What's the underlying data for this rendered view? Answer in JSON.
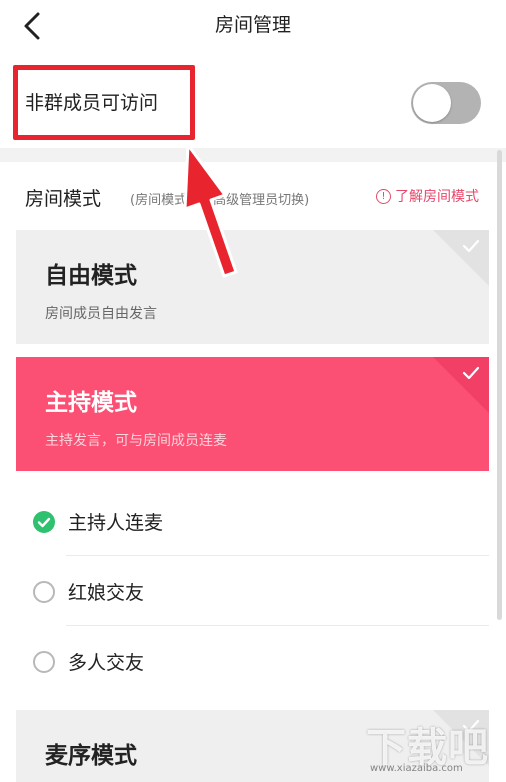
{
  "header": {
    "title": "房间管理",
    "back_icon": "chevron-left-icon"
  },
  "visitor": {
    "label": "非群成员可访问",
    "toggle_on": false
  },
  "room_mode": {
    "title": "房间模式",
    "hint": "(房间模式仅由高级管理员切换)",
    "learn_link": "了解房间模式",
    "info_icon_glyph": "!"
  },
  "modes": {
    "free": {
      "title": "自由模式",
      "desc": "房间成员自由发言"
    },
    "host": {
      "title": "主持模式",
      "desc": "主持发言，可与房间成员连麦"
    },
    "order": {
      "title": "麦序模式"
    }
  },
  "host_options": [
    {
      "label": "主持人连麦",
      "checked": true
    },
    {
      "label": "红娘交友",
      "checked": false
    },
    {
      "label": "多人交友",
      "checked": false
    }
  ],
  "watermark": {
    "text": "下载吧",
    "url": "www.xiazaiba.com"
  },
  "colors": {
    "accent": "#fb4f73",
    "link": "#e8476a",
    "check_green": "#2fc16f",
    "highlight_red": "#e8242f"
  }
}
